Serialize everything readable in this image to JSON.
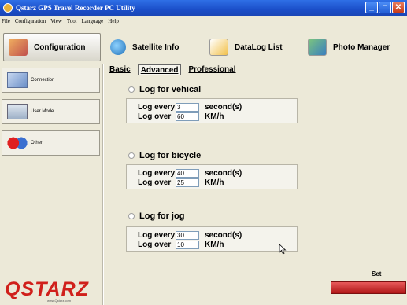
{
  "window": {
    "title": "Qstarz GPS Travel Recorder PC Utility",
    "buttons": [
      "minimize",
      "maximize",
      "close"
    ]
  },
  "menu": [
    "File",
    "Configuration",
    "View",
    "Tool",
    "Language",
    "Help"
  ],
  "main_tabs": [
    {
      "label": "Configuration",
      "icon": "configuration-icon",
      "active": true
    },
    {
      "label": "Satellite Info",
      "icon": "satellite-icon"
    },
    {
      "label": "DataLog List",
      "icon": "datalog-icon"
    },
    {
      "label": "Photo Manager",
      "icon": "photo-icon"
    }
  ],
  "sidebar": {
    "items": [
      {
        "label": "Connection",
        "icon": "connection-icon"
      },
      {
        "label": "User Mode",
        "icon": "user-mode-icon"
      },
      {
        "label": "Other",
        "icon": "other-icon"
      }
    ],
    "logo": "QSTARZ",
    "logo_url": "www.Qstarz.com"
  },
  "sub_tabs": [
    {
      "label": "Basic"
    },
    {
      "label": "Advanced",
      "active": true
    },
    {
      "label": "Professional"
    }
  ],
  "modes": [
    {
      "title": "Log for vehical",
      "every_label": "Log every",
      "every_value": "3",
      "every_unit": "second(s)",
      "over_label": "Log over",
      "over_value": "60",
      "over_unit": "KM/h"
    },
    {
      "title": "Log for bicycle",
      "every_label": "Log every",
      "every_value": "40",
      "every_unit": "second(s)",
      "over_label": "Log over",
      "over_value": "25",
      "over_unit": "KM/h"
    },
    {
      "title": "Log for jog",
      "every_label": "Log every",
      "every_value": "30",
      "every_unit": "second(s)",
      "over_label": "Log over",
      "over_value": "10",
      "over_unit": "KM/h"
    }
  ],
  "set_label": "Set"
}
